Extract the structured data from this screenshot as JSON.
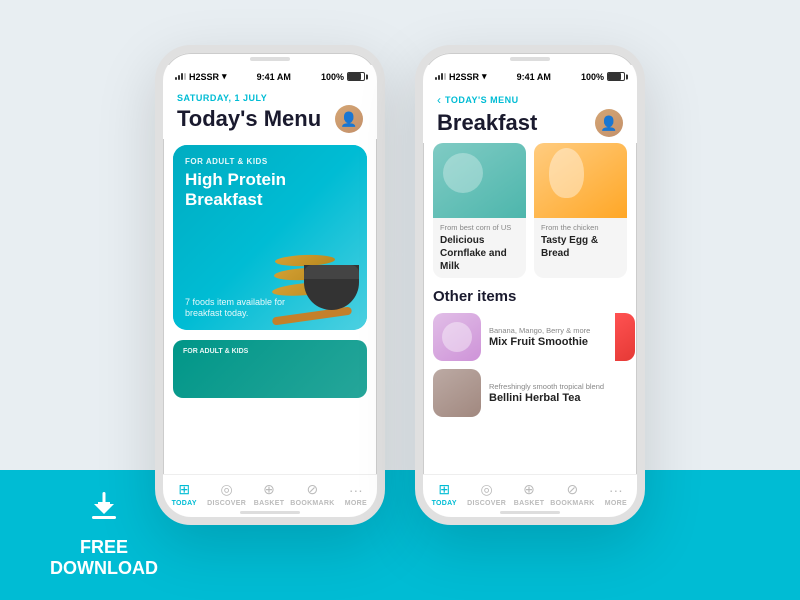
{
  "background": {
    "color": "#e8eef2",
    "bottom_bar_color": "#00bcd4"
  },
  "free_download": {
    "label": "FREE\nDOWNLOAD",
    "icon": "⬇"
  },
  "phone1": {
    "status": {
      "carrier": "H2SSR",
      "time": "9:41 AM",
      "battery": "100%"
    },
    "header": {
      "date": "SATURDAY, 1 JULY",
      "title": "Today's Menu"
    },
    "hero": {
      "tag": "FOR ADULT & KIDS",
      "title": "High Protein Breakfast",
      "subtitle": "7 foods item available for breakfast today."
    },
    "mini_card": {
      "tag": "FOR ADULT & KIDS"
    },
    "nav": [
      {
        "icon": "⊞",
        "label": "TODAY",
        "active": true
      },
      {
        "icon": "◎",
        "label": "DISCOVER",
        "active": false
      },
      {
        "icon": "⊕",
        "label": "BASKET",
        "active": false
      },
      {
        "icon": "⊘",
        "label": "BOOKMARK",
        "active": false
      },
      {
        "icon": "···",
        "label": "MORE",
        "active": false
      }
    ]
  },
  "phone2": {
    "status": {
      "carrier": "H2SSR",
      "time": "9:41 AM",
      "battery": "100%"
    },
    "back_label": "TODAY'S MENU",
    "header": {
      "title": "Breakfast"
    },
    "food_cards": [
      {
        "source": "From best corn of US",
        "name": "Delicious Cornflake and Milk"
      },
      {
        "source": "From the chicken",
        "name": "Tasty Egg & Bread"
      }
    ],
    "other_items_title": "Other items",
    "other_items": [
      {
        "source": "Banana, Mango, Berry & more",
        "name": "Mix Fruit Smoothie",
        "color": "#e1bee7"
      },
      {
        "source": "Refreshingly smooth tropical blend",
        "name": "Bellini Herbal Tea",
        "color": "#bcaaa4"
      }
    ],
    "nav": [
      {
        "icon": "⊞",
        "label": "TODAY",
        "active": true
      },
      {
        "icon": "◎",
        "label": "DISCOVER",
        "active": false
      },
      {
        "icon": "⊕",
        "label": "BASKET",
        "active": false
      },
      {
        "icon": "⊘",
        "label": "BOOKMARK",
        "active": false
      },
      {
        "icon": "···",
        "label": "MORE",
        "active": false
      }
    ]
  }
}
